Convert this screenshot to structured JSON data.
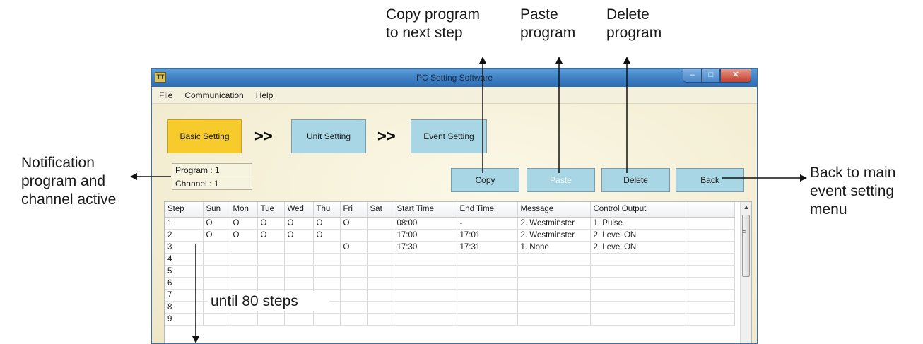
{
  "annotations": {
    "copy": [
      "Copy program",
      "to next step"
    ],
    "paste": [
      "Paste",
      "program"
    ],
    "delete": [
      "Delete",
      "program"
    ],
    "notification": [
      "Notification",
      "program and",
      "channel active"
    ],
    "back": [
      "Back to main",
      "event setting",
      "menu"
    ],
    "steps": "until 80 steps"
  },
  "window": {
    "icon_text": "TT",
    "title": "PC Setting Software",
    "controls": {
      "minimize": "–",
      "maximize": "□",
      "close": "✕"
    }
  },
  "menu": [
    "File",
    "Communication",
    "Help"
  ],
  "steps_nav": {
    "basic": "Basic Setting",
    "unit": "Unit Setting",
    "event": "Event Setting",
    "separator": ">>"
  },
  "info": {
    "program": "Program : 1",
    "channel": "Channel : 1"
  },
  "actions": {
    "copy": "Copy",
    "paste": "Paste",
    "delete": "Delete",
    "back": "Back"
  },
  "table": {
    "columns": [
      "Step",
      "Sun",
      "Mon",
      "Tue",
      "Wed",
      "Thu",
      "Fri",
      "Sat",
      "Start Time",
      "End Time",
      "Message",
      "Control Output",
      ""
    ],
    "rows": [
      [
        "1",
        "O",
        "O",
        "O",
        "O",
        "O",
        "O",
        "",
        "08:00",
        "-",
        "2. Westminster",
        "1. Pulse",
        ""
      ],
      [
        "2",
        "O",
        "O",
        "O",
        "O",
        "O",
        "",
        "",
        "17:00",
        "17:01",
        "2. Westminster",
        "2. Level ON",
        ""
      ],
      [
        "3",
        "",
        "",
        "",
        "",
        "",
        "O",
        "",
        "17:30",
        "17:31",
        "1. None",
        "2. Level ON",
        ""
      ],
      [
        "4",
        "",
        "",
        "",
        "",
        "",
        "",
        "",
        "",
        "",
        "",
        "",
        ""
      ],
      [
        "5",
        "",
        "",
        "",
        "",
        "",
        "",
        "",
        "",
        "",
        "",
        "",
        ""
      ],
      [
        "6",
        "",
        "",
        "",
        "",
        "",
        "",
        "",
        "",
        "",
        "",
        "",
        ""
      ],
      [
        "7",
        "",
        "",
        "",
        "",
        "",
        "",
        "",
        "",
        "",
        "",
        "",
        ""
      ],
      [
        "8",
        "",
        "",
        "",
        "",
        "",
        "",
        "",
        "",
        "",
        "",
        "",
        ""
      ],
      [
        "9",
        "",
        "",
        "",
        "",
        "",
        "",
        "",
        "",
        "",
        "",
        "",
        ""
      ]
    ]
  },
  "scrollbar": {
    "up_arrow": "▲",
    "grip": "≡"
  }
}
